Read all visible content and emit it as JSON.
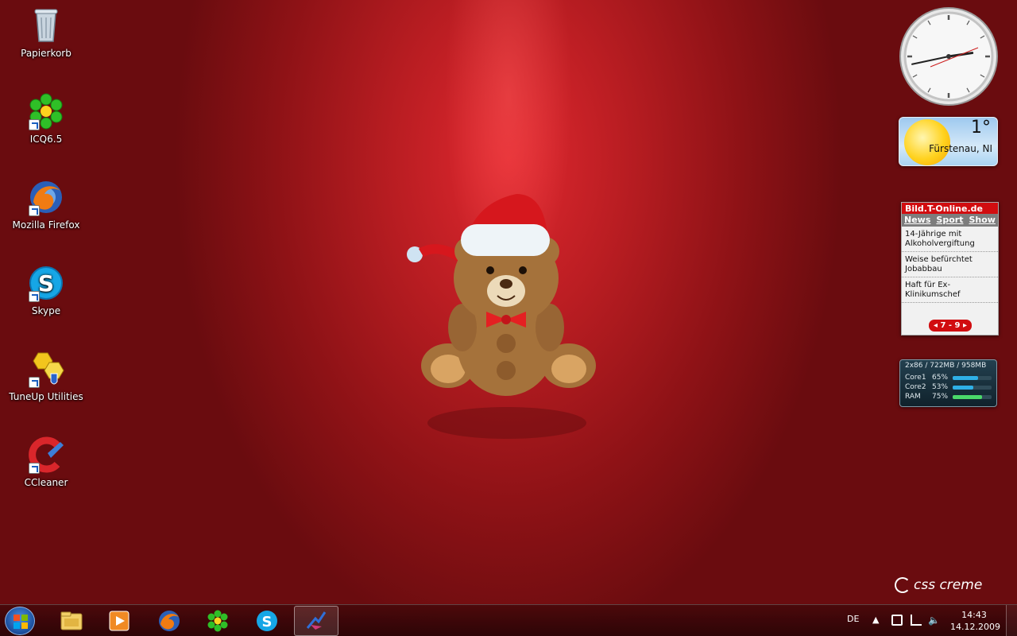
{
  "desktop": {
    "icons": [
      {
        "label": "Papierkorb",
        "icon": "recycle-bin-icon"
      },
      {
        "label": "ICQ6.5",
        "icon": "icq-flower-icon"
      },
      {
        "label": "Mozilla Firefox",
        "icon": "firefox-icon"
      },
      {
        "label": "Skype",
        "icon": "skype-icon"
      },
      {
        "label": "TuneUp Utilities",
        "icon": "tuneup-icon"
      },
      {
        "label": "CCleaner",
        "icon": "ccleaner-icon"
      }
    ]
  },
  "gadgets": {
    "clock": {
      "hour": 14,
      "minute": 43
    },
    "weather": {
      "temperature": "1°",
      "location": "Fürstenau, NI",
      "icon": "sun-icon"
    },
    "news": {
      "source": "Bild.T-Online.de",
      "tabs": [
        "News",
        "Sport",
        "Show"
      ],
      "items": [
        "14-Jährige mit Alkoholvergiftung",
        "Weise befürchtet Jobabbau",
        "Haft für Ex-Klinikumschef"
      ],
      "pager": "7 - 9"
    },
    "cpu": {
      "header": "2x86 / 722MB / 958MB",
      "rows": [
        {
          "label": "Core1",
          "value": "65%",
          "level": 0.65,
          "color": "#2fb0e6"
        },
        {
          "label": "Core2",
          "value": "53%",
          "level": 0.53,
          "color": "#2fb0e6"
        },
        {
          "label": "RAM",
          "value": "75%",
          "level": 0.75,
          "color": "#4ad86a"
        }
      ]
    }
  },
  "brand": {
    "text": "css creme"
  },
  "taskbar": {
    "pinned": [
      "windows-explorer-icon",
      "media-player-icon",
      "firefox-icon",
      "icq-flower-icon",
      "skype-icon",
      "app-active-icon"
    ],
    "tray": {
      "language": "DE",
      "time": "14:43",
      "date": "14.12.2009"
    }
  },
  "colors": {
    "background": "#9e161b",
    "accent": "#d10d10"
  }
}
